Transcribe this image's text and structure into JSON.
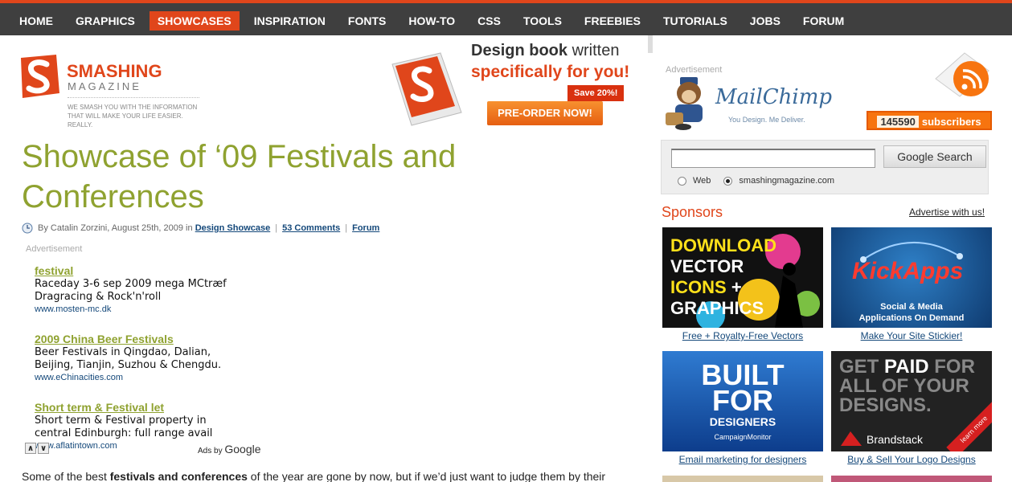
{
  "nav": {
    "items": [
      "Home",
      "Graphics",
      "Showcases",
      "Inspiration",
      "Fonts",
      "How-To",
      "CSS",
      "Tools",
      "Freebies",
      "Tutorials",
      "Jobs",
      "Forum"
    ]
  },
  "logo": {
    "name": "SMASHING",
    "sub": "MAGAZINE",
    "tagline": "We smash you with the information that will make your life easier. Really."
  },
  "banner": {
    "line1_bold": "Design book",
    "line1_rest": " written",
    "line2": "specifically for you!",
    "save": "Save 20%!",
    "cta": "PRE-ORDER NOW!"
  },
  "article": {
    "title": "Showcase of ‘09 Festivals and Conferences",
    "meta_prefix": "By Catalin Zorzini, August 25th, 2009 in",
    "category": "Design Showcase",
    "comments": "53 Comments",
    "forum": "Forum",
    "intro_start": "Some of the best ",
    "intro_bold": "festivals and conferences",
    "intro_end": " of the year are gone by now, but if we’d just want to judge them by their"
  },
  "ads": {
    "label": "Advertisement",
    "items": [
      {
        "title": "festival",
        "line1": "Raceday 3-6 sep 2009 mega MCtræf",
        "line2": "Dragracing & Rock'n'roll",
        "url": "www.mosten-mc.dk"
      },
      {
        "title": "2009 China Beer Festivals",
        "line1": "Beer Festivals in Qingdao, Dalian,",
        "line2": "Beijing, Tianjin, Suzhou & Chengdu.",
        "url": "www.eChinacities.com"
      },
      {
        "title": "Short term & Festival let",
        "line1": "Short term & Festival property in",
        "line2": "central Edinburgh: full range avail",
        "url": "www.aflatintown.com"
      }
    ],
    "prev": "∧",
    "next": "∨",
    "ads_by": "Ads by",
    "google": "Google"
  },
  "sidebar": {
    "ad_label": "Advertisement",
    "mailchimp": {
      "name": "MailChimp",
      "tagline": "You Design. Me Deliver."
    },
    "subscribers": {
      "count": "145590",
      "label": "subscribers"
    },
    "search": {
      "button": "Google Search",
      "opt_web": "Web",
      "opt_site": "smashingmagazine.com"
    },
    "sponsors_title": "Sponsors",
    "advertise": "Advertise with us!",
    "sponsors": [
      {
        "caption": "Free + Royalty-Free Vectors",
        "l1": "DOWNLOAD",
        "l2": "VECTOR",
        "l3": "ICONS",
        "l3b": "+",
        "l4": "GRAPHICS"
      },
      {
        "caption": "Make Your Site Stickier!",
        "logo": "KickApps",
        "sub1": "Social & Media",
        "sub2": "Applications On Demand"
      },
      {
        "caption": "Email marketing for designers",
        "l1": "BUILT",
        "l2": "FOR",
        "l3": "DESIGNERS",
        "brand": "CampaignMonitor"
      },
      {
        "caption": "Buy & Sell Your Logo Designs",
        "l1a": "GET",
        "l1b": "PAID",
        "l1c": "FOR",
        "l2": "ALL OF YOUR",
        "l3": "DESIGNS.",
        "brand": "Brandstack",
        "ribbon": "learn more"
      }
    ]
  },
  "colors": {
    "accent": "#e0461b",
    "title_green": "#8fa230",
    "link": "#14487a",
    "nav_bg": "#3f3f3f"
  }
}
